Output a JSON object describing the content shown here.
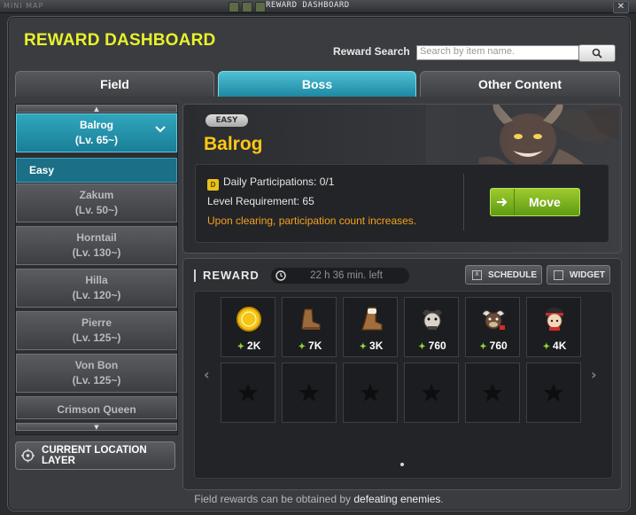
{
  "topbar": {
    "minimap_label": "MINI MAP",
    "window_title": "REWARD DASHBOARD",
    "close_label": "✕"
  },
  "header": {
    "title": "REWARD DASHBOARD",
    "search_label": "Reward Search",
    "search_placeholder": "Search by item name."
  },
  "tabs": [
    {
      "label": "Field"
    },
    {
      "label": "Boss"
    },
    {
      "label": "Other Content"
    }
  ],
  "tabs_selected": "Boss",
  "boss_list": [
    {
      "name": "Balrog",
      "level": "(Lv. 65~)"
    },
    {
      "name": "Zakum",
      "level": "(Lv. 50~)"
    },
    {
      "name": "Horntail",
      "level": "(Lv. 130~)"
    },
    {
      "name": "Hilla",
      "level": "(Lv. 120~)"
    },
    {
      "name": "Pierre",
      "level": "(Lv. 125~)"
    },
    {
      "name": "Von Bon",
      "level": "(Lv. 125~)"
    },
    {
      "name": "Crimson Queen",
      "level": ""
    }
  ],
  "selected_difficulty": "Easy",
  "current_location_label": "CURRENT LOCATION LAYER",
  "boss_info": {
    "difficulty_badge": "EASY",
    "name": "Balrog",
    "daily_participations": "Daily Participations: 0/1",
    "level_requirement": "Level Requirement: 65",
    "clear_note": "Upon clearing, participation count increases.",
    "move_label": "Move",
    "daily_icon": "D"
  },
  "reward": {
    "title": "REWARD",
    "time_left": "22 h 36 min. left",
    "schedule_label": "SCHEDULE",
    "widget_label": "WIDGET",
    "items": [
      {
        "icon": "gold-coin-icon",
        "qty": "2K"
      },
      {
        "icon": "brown-shoe-icon",
        "qty": "7K"
      },
      {
        "icon": "fur-boot-icon",
        "qty": "3K"
      },
      {
        "icon": "goat-mask-icon",
        "qty": "760"
      },
      {
        "icon": "bull-mask-icon",
        "qty": "760"
      },
      {
        "icon": "character-head-icon",
        "qty": "4K"
      }
    ],
    "empty_slots": 6
  },
  "footer": {
    "text_before": "Field rewards can be obtained by ",
    "text_bold": "defeating enemies",
    "text_after": "."
  },
  "colors": {
    "accent_yellow": "#e8f22a",
    "boss_gold": "#ffc814",
    "teal": "#1d88a3",
    "orange_note": "#f5a21e",
    "move_green": "#7cb61f"
  }
}
